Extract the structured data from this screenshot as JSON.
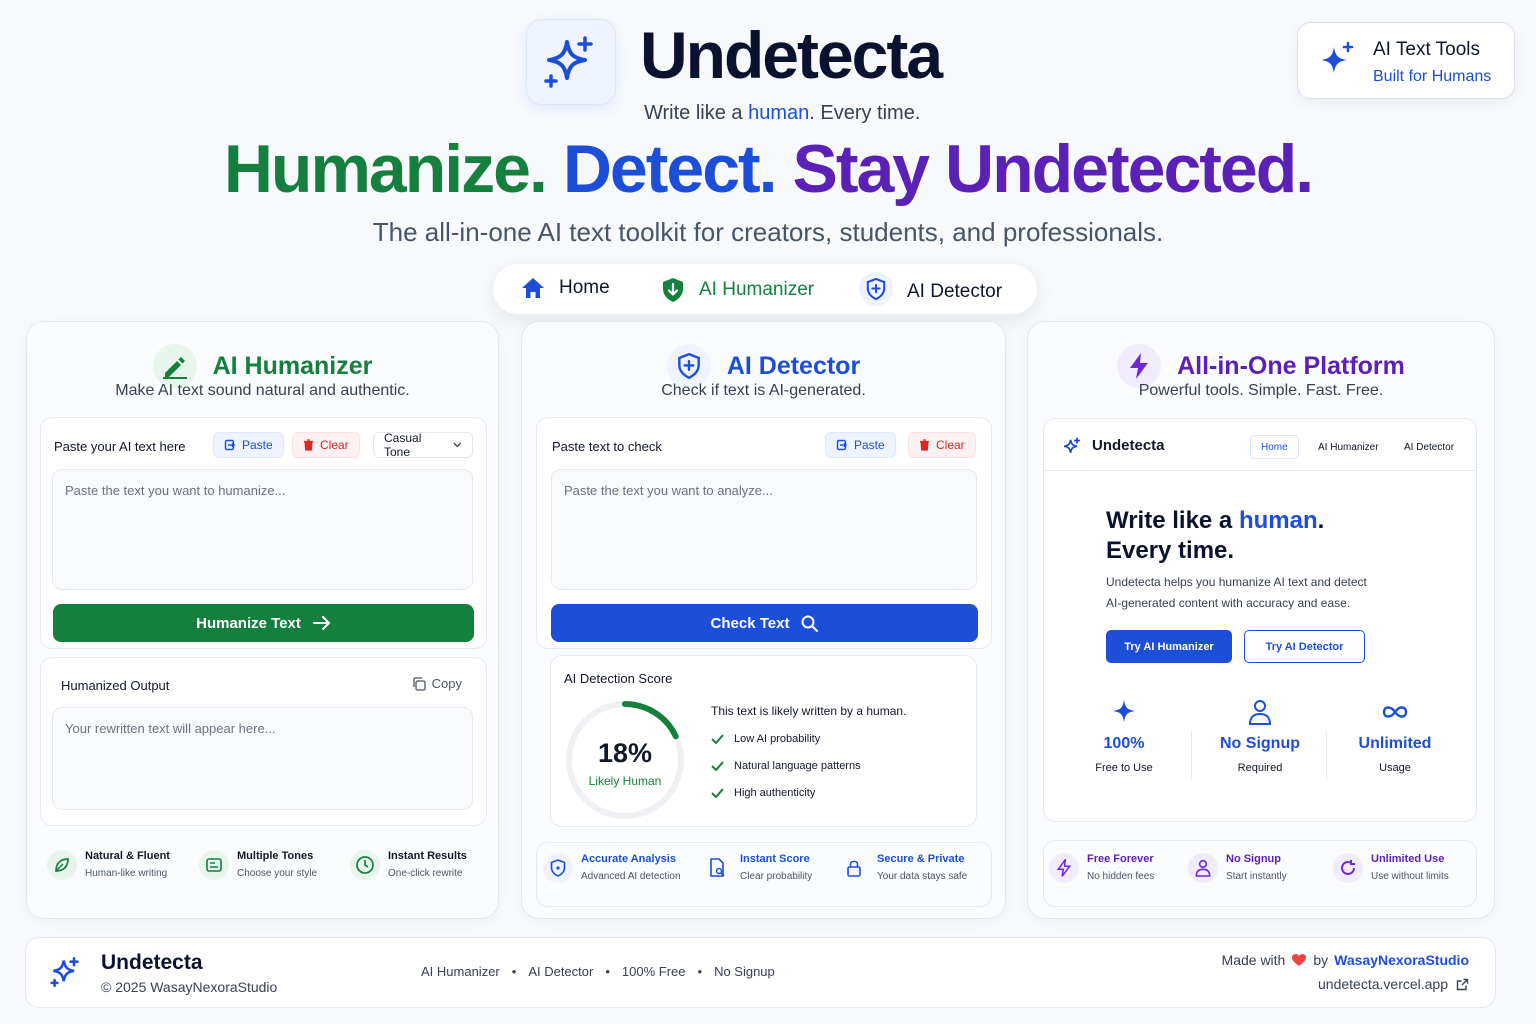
{
  "header": {
    "brand": "Undetecta",
    "tagline_pre": "Write like a ",
    "tagline_hl": "human",
    "tagline_post": ". Every time.",
    "badge_title": "AI Text Tools",
    "badge_sub": "Built for Humans"
  },
  "hero": {
    "h1": "Humanize.",
    "h2": "Detect.",
    "h3": "Stay Undetected.",
    "subtitle": "The all-in-one AI text toolkit for creators, students, and professionals."
  },
  "nav": {
    "home": "Home",
    "humanizer": "AI Humanizer",
    "detector": "AI Detector"
  },
  "humanizer": {
    "title": "AI Humanizer",
    "subtitle": "Make AI text sound natural and authentic.",
    "input_label": "Paste your AI text here",
    "paste": "Paste",
    "clear": "Clear",
    "tone": "Casual Tone",
    "placeholder": "Paste the text you want to humanize...",
    "button": "Humanize Text",
    "output_label": "Humanized Output",
    "copy": "Copy",
    "output_placeholder": "Your rewritten text will appear here...",
    "features": [
      {
        "title": "Natural & Fluent",
        "sub": "Human-like writing"
      },
      {
        "title": "Multiple Tones",
        "sub": "Choose your style"
      },
      {
        "title": "Instant Results",
        "sub": "One-click rewrite"
      }
    ]
  },
  "detector": {
    "title": "AI Detector",
    "subtitle": "Check if text is AI-generated.",
    "input_label": "Paste text to check",
    "paste": "Paste",
    "clear": "Clear",
    "placeholder": "Paste the text you want to analyze...",
    "button": "Check Text",
    "score_label": "AI Detection Score",
    "score_value": "18%",
    "score_fraction": 0.18,
    "score_caption": "Likely Human",
    "verdict": "This text is likely written by a human.",
    "checks": [
      "Low AI probability",
      "Natural language patterns",
      "High authenticity"
    ],
    "features": [
      {
        "title": "Accurate Analysis",
        "sub": "Advanced AI detection"
      },
      {
        "title": "Instant Score",
        "sub": "Clear probability"
      },
      {
        "title": "Secure & Private",
        "sub": "Your data stays safe"
      }
    ]
  },
  "platform": {
    "title": "All-in-One Platform",
    "subtitle": "Powerful tools. Simple. Fast. Free.",
    "mini": {
      "brand": "Undetecta",
      "nav": [
        "Home",
        "AI Humanizer",
        "AI Detector"
      ],
      "h_pre": "Write like a ",
      "h_hl": "human",
      "h_post": ".",
      "h_line2": "Every time.",
      "desc1": "Undetecta helps you humanize AI text and detect",
      "desc2": "AI-generated content with accuracy and ease.",
      "btn1": "Try AI Humanizer",
      "btn2": "Try AI Detector",
      "stats": [
        {
          "value": "100%",
          "label": "Free to Use"
        },
        {
          "value": "No Signup",
          "label": "Required"
        },
        {
          "value": "Unlimited",
          "label": "Usage"
        }
      ]
    },
    "features": [
      {
        "title": "Free Forever",
        "sub": "No hidden fees"
      },
      {
        "title": "No Signup",
        "sub": "Start instantly"
      },
      {
        "title": "Unlimited Use",
        "sub": "Use without limits"
      }
    ]
  },
  "footer": {
    "brand": "Undetecta",
    "copyright": "© 2025 WasayNexoraStudio",
    "links": [
      "AI Humanizer",
      "AI Detector",
      "100% Free",
      "No Signup"
    ],
    "made_with": "Made with",
    "by": "by",
    "studio": "WasayNexoraStudio",
    "url": "undetecta.vercel.app"
  },
  "colors": {
    "green": "#15803d",
    "blue": "#1d4ed8",
    "purple": "#5b21b6",
    "red": "#dc2626"
  }
}
